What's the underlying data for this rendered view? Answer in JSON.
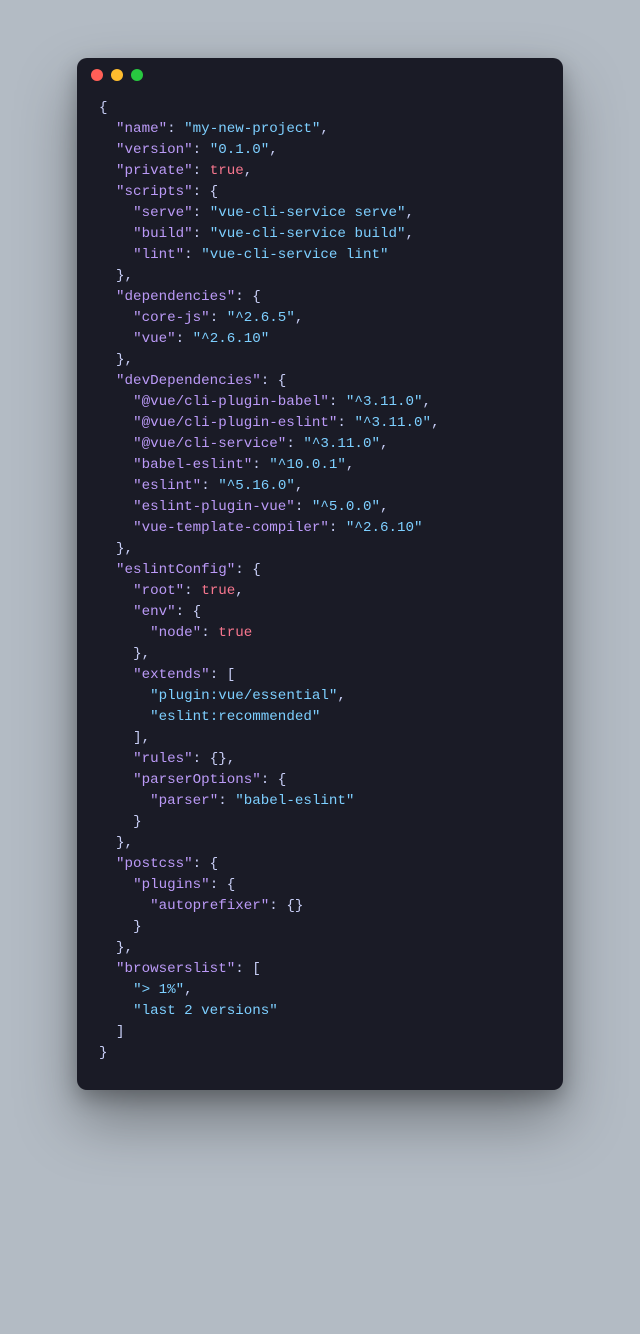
{
  "window": {
    "buttons": [
      "close",
      "minimize",
      "zoom"
    ]
  },
  "indent": "  ",
  "code_lines": [
    [
      [
        "p",
        "{"
      ]
    ],
    [
      [
        "i",
        1
      ],
      [
        "k",
        "\"name\""
      ],
      [
        "p",
        ": "
      ],
      [
        "s",
        "\"my-new-project\""
      ],
      [
        "p",
        ","
      ]
    ],
    [
      [
        "i",
        1
      ],
      [
        "k",
        "\"version\""
      ],
      [
        "p",
        ": "
      ],
      [
        "s",
        "\"0.1.0\""
      ],
      [
        "p",
        ","
      ]
    ],
    [
      [
        "i",
        1
      ],
      [
        "k",
        "\"private\""
      ],
      [
        "p",
        ": "
      ],
      [
        "b",
        "true"
      ],
      [
        "p",
        ","
      ]
    ],
    [
      [
        "i",
        1
      ],
      [
        "k",
        "\"scripts\""
      ],
      [
        "p",
        ": {"
      ]
    ],
    [
      [
        "i",
        2
      ],
      [
        "k",
        "\"serve\""
      ],
      [
        "p",
        ": "
      ],
      [
        "s",
        "\"vue-cli-service serve\""
      ],
      [
        "p",
        ","
      ]
    ],
    [
      [
        "i",
        2
      ],
      [
        "k",
        "\"build\""
      ],
      [
        "p",
        ": "
      ],
      [
        "s",
        "\"vue-cli-service build\""
      ],
      [
        "p",
        ","
      ]
    ],
    [
      [
        "i",
        2
      ],
      [
        "k",
        "\"lint\""
      ],
      [
        "p",
        ": "
      ],
      [
        "s",
        "\"vue-cli-service lint\""
      ]
    ],
    [
      [
        "i",
        1
      ],
      [
        "p",
        "},"
      ]
    ],
    [
      [
        "i",
        1
      ],
      [
        "k",
        "\"dependencies\""
      ],
      [
        "p",
        ": {"
      ]
    ],
    [
      [
        "i",
        2
      ],
      [
        "k",
        "\"core-js\""
      ],
      [
        "p",
        ": "
      ],
      [
        "s",
        "\"^2.6.5\""
      ],
      [
        "p",
        ","
      ]
    ],
    [
      [
        "i",
        2
      ],
      [
        "k",
        "\"vue\""
      ],
      [
        "p",
        ": "
      ],
      [
        "s",
        "\"^2.6.10\""
      ]
    ],
    [
      [
        "i",
        1
      ],
      [
        "p",
        "},"
      ]
    ],
    [
      [
        "i",
        1
      ],
      [
        "k",
        "\"devDependencies\""
      ],
      [
        "p",
        ": {"
      ]
    ],
    [
      [
        "i",
        2
      ],
      [
        "k",
        "\"@vue/cli-plugin-babel\""
      ],
      [
        "p",
        ": "
      ],
      [
        "s",
        "\"^3.11.0\""
      ],
      [
        "p",
        ","
      ]
    ],
    [
      [
        "i",
        2
      ],
      [
        "k",
        "\"@vue/cli-plugin-eslint\""
      ],
      [
        "p",
        ": "
      ],
      [
        "s",
        "\"^3.11.0\""
      ],
      [
        "p",
        ","
      ]
    ],
    [
      [
        "i",
        2
      ],
      [
        "k",
        "\"@vue/cli-service\""
      ],
      [
        "p",
        ": "
      ],
      [
        "s",
        "\"^3.11.0\""
      ],
      [
        "p",
        ","
      ]
    ],
    [
      [
        "i",
        2
      ],
      [
        "k",
        "\"babel-eslint\""
      ],
      [
        "p",
        ": "
      ],
      [
        "s",
        "\"^10.0.1\""
      ],
      [
        "p",
        ","
      ]
    ],
    [
      [
        "i",
        2
      ],
      [
        "k",
        "\"eslint\""
      ],
      [
        "p",
        ": "
      ],
      [
        "s",
        "\"^5.16.0\""
      ],
      [
        "p",
        ","
      ]
    ],
    [
      [
        "i",
        2
      ],
      [
        "k",
        "\"eslint-plugin-vue\""
      ],
      [
        "p",
        ": "
      ],
      [
        "s",
        "\"^5.0.0\""
      ],
      [
        "p",
        ","
      ]
    ],
    [
      [
        "i",
        2
      ],
      [
        "k",
        "\"vue-template-compiler\""
      ],
      [
        "p",
        ": "
      ],
      [
        "s",
        "\"^2.6.10\""
      ]
    ],
    [
      [
        "i",
        1
      ],
      [
        "p",
        "},"
      ]
    ],
    [
      [
        "i",
        1
      ],
      [
        "k",
        "\"eslintConfig\""
      ],
      [
        "p",
        ": {"
      ]
    ],
    [
      [
        "i",
        2
      ],
      [
        "k",
        "\"root\""
      ],
      [
        "p",
        ": "
      ],
      [
        "b",
        "true"
      ],
      [
        "p",
        ","
      ]
    ],
    [
      [
        "i",
        2
      ],
      [
        "k",
        "\"env\""
      ],
      [
        "p",
        ": {"
      ]
    ],
    [
      [
        "i",
        3
      ],
      [
        "k",
        "\"node\""
      ],
      [
        "p",
        ": "
      ],
      [
        "b",
        "true"
      ]
    ],
    [
      [
        "i",
        2
      ],
      [
        "p",
        "},"
      ]
    ],
    [
      [
        "i",
        2
      ],
      [
        "k",
        "\"extends\""
      ],
      [
        "p",
        ": ["
      ]
    ],
    [
      [
        "i",
        3
      ],
      [
        "s",
        "\"plugin:vue/essential\""
      ],
      [
        "p",
        ","
      ]
    ],
    [
      [
        "i",
        3
      ],
      [
        "s",
        "\"eslint:recommended\""
      ]
    ],
    [
      [
        "i",
        2
      ],
      [
        "p",
        "],"
      ]
    ],
    [
      [
        "i",
        2
      ],
      [
        "k",
        "\"rules\""
      ],
      [
        "p",
        ": {},"
      ]
    ],
    [
      [
        "i",
        2
      ],
      [
        "k",
        "\"parserOptions\""
      ],
      [
        "p",
        ": {"
      ]
    ],
    [
      [
        "i",
        3
      ],
      [
        "k",
        "\"parser\""
      ],
      [
        "p",
        ": "
      ],
      [
        "s",
        "\"babel-eslint\""
      ]
    ],
    [
      [
        "i",
        2
      ],
      [
        "p",
        "}"
      ]
    ],
    [
      [
        "i",
        1
      ],
      [
        "p",
        "},"
      ]
    ],
    [
      [
        "i",
        1
      ],
      [
        "k",
        "\"postcss\""
      ],
      [
        "p",
        ": {"
      ]
    ],
    [
      [
        "i",
        2
      ],
      [
        "k",
        "\"plugins\""
      ],
      [
        "p",
        ": {"
      ]
    ],
    [
      [
        "i",
        3
      ],
      [
        "k",
        "\"autoprefixer\""
      ],
      [
        "p",
        ": {}"
      ]
    ],
    [
      [
        "i",
        2
      ],
      [
        "p",
        "}"
      ]
    ],
    [
      [
        "i",
        1
      ],
      [
        "p",
        "},"
      ]
    ],
    [
      [
        "i",
        1
      ],
      [
        "k",
        "\"browserslist\""
      ],
      [
        "p",
        ": ["
      ]
    ],
    [
      [
        "i",
        2
      ],
      [
        "s",
        "\"> 1%\""
      ],
      [
        "p",
        ","
      ]
    ],
    [
      [
        "i",
        2
      ],
      [
        "s",
        "\"last 2 versions\""
      ]
    ],
    [
      [
        "i",
        1
      ],
      [
        "p",
        "]"
      ]
    ],
    [
      [
        "p",
        "}"
      ]
    ]
  ]
}
